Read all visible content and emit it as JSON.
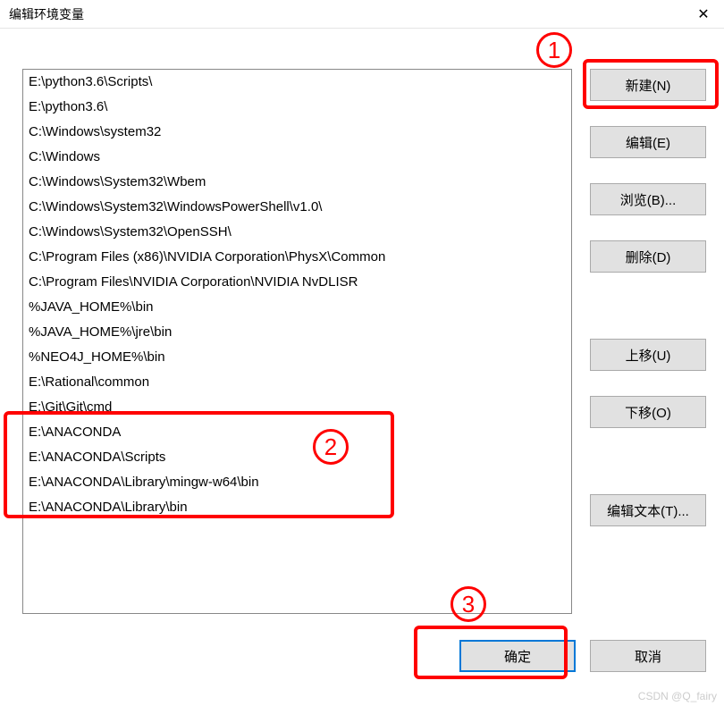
{
  "window": {
    "title": "编辑环境变量"
  },
  "paths": [
    "E:\\python3.6\\Scripts\\",
    "E:\\python3.6\\",
    "C:\\Windows\\system32",
    "C:\\Windows",
    "C:\\Windows\\System32\\Wbem",
    "C:\\Windows\\System32\\WindowsPowerShell\\v1.0\\",
    "C:\\Windows\\System32\\OpenSSH\\",
    "C:\\Program Files (x86)\\NVIDIA Corporation\\PhysX\\Common",
    "C:\\Program Files\\NVIDIA Corporation\\NVIDIA NvDLISR",
    "%JAVA_HOME%\\bin",
    "%JAVA_HOME%\\jre\\bin",
    "%NEO4J_HOME%\\bin",
    "E:\\Rational\\common",
    "E:\\Git\\Git\\cmd",
    "E:\\ANACONDA",
    "E:\\ANACONDA\\Scripts",
    "E:\\ANACONDA\\Library\\mingw-w64\\bin",
    "E:\\ANACONDA\\Library\\bin"
  ],
  "buttons": {
    "new": "新建(N)",
    "edit": "编辑(E)",
    "browse": "浏览(B)...",
    "delete": "删除(D)",
    "moveup": "上移(U)",
    "movedown": "下移(O)",
    "edittext": "编辑文本(T)...",
    "ok": "确定",
    "cancel": "取消"
  },
  "annotations": {
    "n1": "1",
    "n2": "2",
    "n3": "3"
  },
  "watermark": "CSDN @Q_fairy"
}
